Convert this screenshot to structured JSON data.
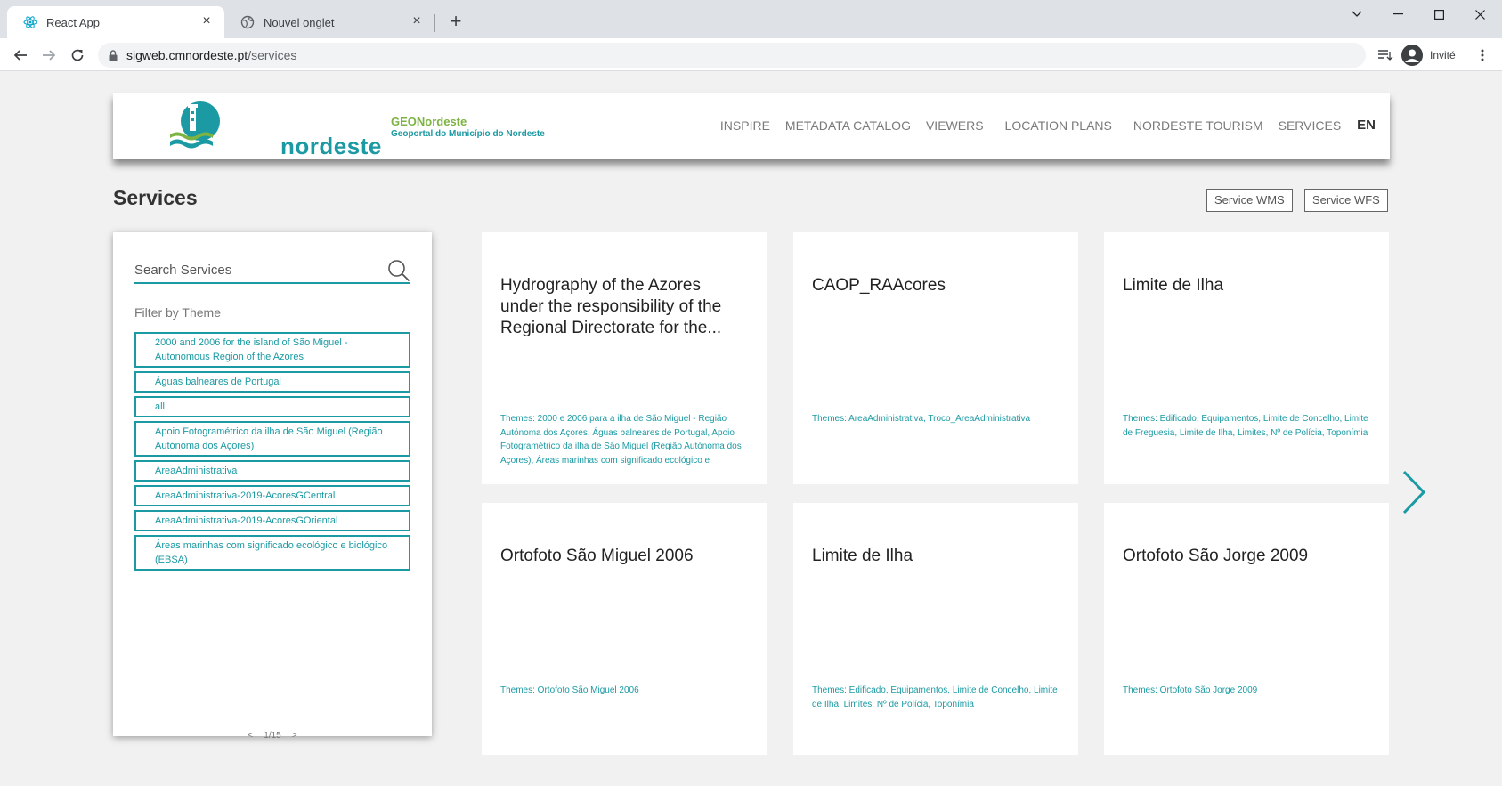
{
  "browser": {
    "tabs": [
      {
        "title": "React App",
        "icon": "react-icon"
      },
      {
        "title": "Nouvel onglet",
        "icon": "globe-icon"
      }
    ],
    "url_host": "sigweb.cmnordeste.pt",
    "url_path": "/services",
    "profile_label": "Invité"
  },
  "header": {
    "logo_text": "nordeste",
    "geo_title": "GEONordeste",
    "geo_subtitle": "Geoportal do Município do Nordeste",
    "menu": [
      "INSPIRE",
      "METADATA CATALOG",
      "VIEWERS",
      "LOCATION PLANS",
      "NORDESTE TOURISM",
      "SERVICES"
    ],
    "lang": "EN"
  },
  "page": {
    "title": "Services",
    "wms_label": "Service WMS",
    "wfs_label": "Service WFS"
  },
  "filters": {
    "search_placeholder": "Search Services",
    "title": "Filter by Theme",
    "themes": [
      "2000 and 2006 for the island of São Miguel - Autonomous Region of the Azores",
      "Águas balneares de Portugal",
      "all",
      "Apoio Fotogramétrico da ilha de São Miguel (Região Autónoma dos Açores)",
      "AreaAdministrativa",
      "AreaAdministrativa-2019-AcoresGCentral",
      "AreaAdministrativa-2019-AcoresGOriental",
      "Áreas marinhas com significado ecológico e biológico (EBSA)"
    ],
    "pager_prev": "<",
    "pager_text": "1/15",
    "pager_next": ">"
  },
  "cards": [
    {
      "title": "Hydrography of the Azores under the responsibility of the Regional Directorate for the...",
      "themes": "Themes: 2000 e 2006 para a ilha de São Miguel - Região Autónoma dos Açores, Águas balneares de Portugal, Apoio Fotogramétrico da ilha de São Miguel (Região Autónoma dos Açores), Áreas marinhas com significado ecológico e"
    },
    {
      "title": "CAOP_RAAcores",
      "themes": "Themes: AreaAdministrativa, Troco_AreaAdministrativa"
    },
    {
      "title": "Limite de Ilha",
      "themes": "Themes: Edificado, Equipamentos, Limite de Concelho, Limite de Freguesia, Limite de Ilha, Limites, Nº de Polícia, Toponímia"
    },
    {
      "title": "Ortofoto São Miguel 2006",
      "themes": "Themes: Ortofoto São Miguel 2006"
    },
    {
      "title": "Limite de Ilha",
      "themes": "Themes: Edificado, Equipamentos, Limite de Concelho, Limite de Ilha, Limites, Nº de Polícia, Toponímia"
    },
    {
      "title": "Ortofoto São Jorge 2009",
      "themes": "Themes: Ortofoto São Jorge 2009"
    }
  ],
  "colors": {
    "accent": "#1b9aa3",
    "green": "#7cb342"
  }
}
